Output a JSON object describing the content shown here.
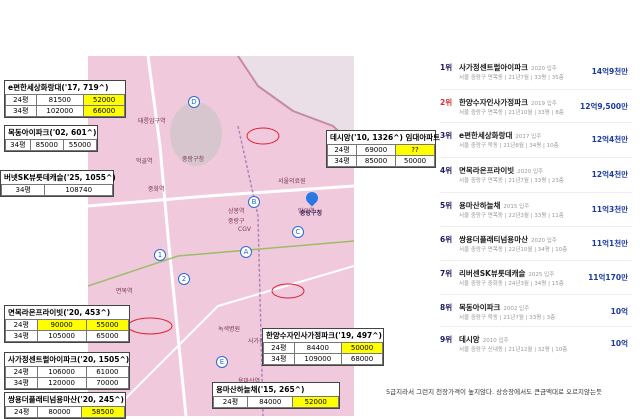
{
  "map": {
    "pin_label": "중랑구청",
    "place_labels": [
      "중랑구청",
      "중랑구",
      "CGV",
      "녹색병원",
      "서울의료원",
      "면목역",
      "사가정역",
      "용마산역",
      "망우역",
      "상봉역",
      "중화역",
      "먹골역",
      "태릉입구역"
    ],
    "markers": [
      "D",
      "E",
      "A",
      "B",
      "C",
      "1",
      "2"
    ]
  },
  "boxes": [
    {
      "title": "e편한세상화랑대('17, 719^)",
      "rows": [
        [
          "24평",
          "81500",
          "52000"
        ],
        [
          "34평",
          "102000",
          "66000"
        ]
      ],
      "hl": [
        2
      ]
    },
    {
      "title": "목동아이파크('02, 601^)",
      "rows": [
        [
          "34평",
          "85000",
          "55000"
        ]
      ],
      "hl": []
    },
    {
      "title": "버넷SK뷰롯데캐슬('25, 1055^)",
      "rows": [
        [
          "34평",
          "108740"
        ]
      ],
      "hl": []
    },
    {
      "title": "데시앙('10, 1326^) 임대아파트",
      "rows": [
        [
          "24평",
          "69000",
          "??"
        ],
        [
          "34평",
          "85000",
          "50000"
        ]
      ],
      "hl": [
        2
      ]
    },
    {
      "title": "면목라온프라이빗('20, 453^)",
      "rows": [
        [
          "24평",
          "90000",
          "55000"
        ],
        [
          "34평",
          "105000",
          "65000"
        ]
      ],
      "hl": [
        1,
        2
      ]
    },
    {
      "title": "한양수자인사가정파크('19, 497^)",
      "rows": [
        [
          "24평",
          "84400",
          "50000"
        ],
        [
          "34평",
          "109000",
          "68000"
        ]
      ],
      "hl": [
        2
      ]
    },
    {
      "title": "사가정센트럴아이파크('20, 1505^)",
      "rows": [
        [
          "24평",
          "106000",
          "61000"
        ],
        [
          "34평",
          "120000",
          "70000"
        ]
      ],
      "hl": []
    },
    {
      "title": "용마산하늘채('15, 265^)",
      "rows": [
        [
          "24평",
          "84000",
          "52000"
        ]
      ],
      "hl": [
        2
      ]
    },
    {
      "title": "쌍용더플래티넘용마산('20, 245^)",
      "rows": [
        [
          "24평",
          "80000",
          "58500"
        ]
      ],
      "hl": [
        2
      ]
    }
  ],
  "ranking": [
    {
      "rank": "1위",
      "name": "사가정센트럴아이파크",
      "year": "2020 입주",
      "sub": "서울 중랑구 면목동 | 21년7월 | 33평 | 35층",
      "price": "14억9천만",
      "red": false
    },
    {
      "rank": "2위",
      "name": "한양수자인사가정파크",
      "year": "2019 입주",
      "sub": "서울 중랑구 면목동 | 21년10월 | 33평 | 8층",
      "price": "12억9,500만",
      "red": true
    },
    {
      "rank": "3위",
      "name": "e편한세상화랑대",
      "year": "2017 입주",
      "sub": "서울 중랑구 묵동 | 21년8월 | 34평 | 10층",
      "price": "12억4천만",
      "red": false
    },
    {
      "rank": "4위",
      "name": "면목라온프라이빗",
      "year": "2020 입주",
      "sub": "서울 중랑구 면목동 | 21년7월 | 33평 | 23층",
      "price": "12억4천만",
      "red": false
    },
    {
      "rank": "5위",
      "name": "용마산하늘채",
      "year": "2015 입주",
      "sub": "서울 중랑구 면목동 | 22년3월 | 33평 | 11층",
      "price": "11억3천만",
      "red": false
    },
    {
      "rank": "6위",
      "name": "쌍용더플래티넘용마산",
      "year": "2020 입주",
      "sub": "서울 중랑구 면목동 | 22년10월 | 34평 | 10층",
      "price": "11억1천만",
      "red": false
    },
    {
      "rank": "7위",
      "name": "리버센SK뷰롯데캐슬",
      "year": "2025 입주",
      "sub": "서울 중랑구 중화동 | 24년3월 | 34평 | 15층",
      "price": "11억170만",
      "red": false
    },
    {
      "rank": "8위",
      "name": "목동아이파크",
      "year": "2002 입주",
      "sub": "서울 중랑구 묵동 | 21년7월 | 33평 | 3층",
      "price": "10억",
      "red": false
    },
    {
      "rank": "9위",
      "name": "데시앙",
      "year": "2010 입주",
      "sub": "서울 중랑구 신내동 | 21년12월 | 32평 | 10층",
      "price": "10억",
      "red": false
    }
  ],
  "note": "5급지라서 그런지 천장가격이 높지않다. 상승장에서도 큰금액대로 오르지않는듯"
}
